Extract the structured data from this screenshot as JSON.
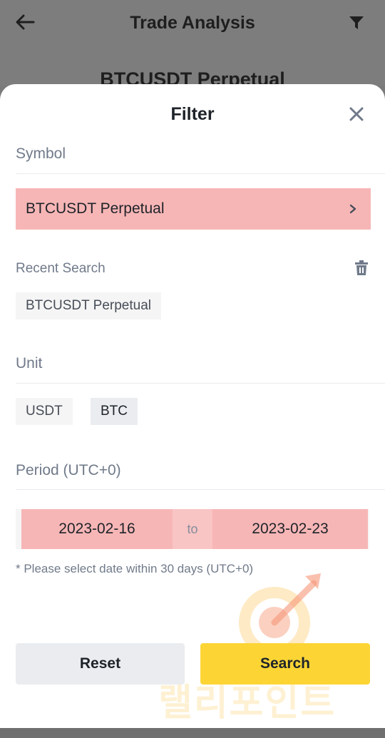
{
  "header": {
    "title": "Trade Analysis",
    "subtitle": "BTCUSDT Perpetual"
  },
  "sheet": {
    "title": "Filter",
    "symbol": {
      "label": "Symbol",
      "selected": "BTCUSDT Perpetual"
    },
    "recent": {
      "label": "Recent Search",
      "items": [
        "BTCUSDT Perpetual"
      ]
    },
    "unit": {
      "label": "Unit",
      "options": [
        "USDT",
        "BTC"
      ],
      "selected": "BTC"
    },
    "period": {
      "label": "Period (UTC+0)",
      "start": "2023-02-16",
      "separator": "to",
      "end": "2023-02-23",
      "note": "* Please select date within 30 days (UTC+0)"
    },
    "buttons": {
      "reset": "Reset",
      "search": "Search"
    }
  },
  "watermark": {
    "text": "랠리포인트"
  },
  "colors": {
    "accent_yellow": "#FCD535",
    "highlight_red": "#F7B6B6"
  }
}
